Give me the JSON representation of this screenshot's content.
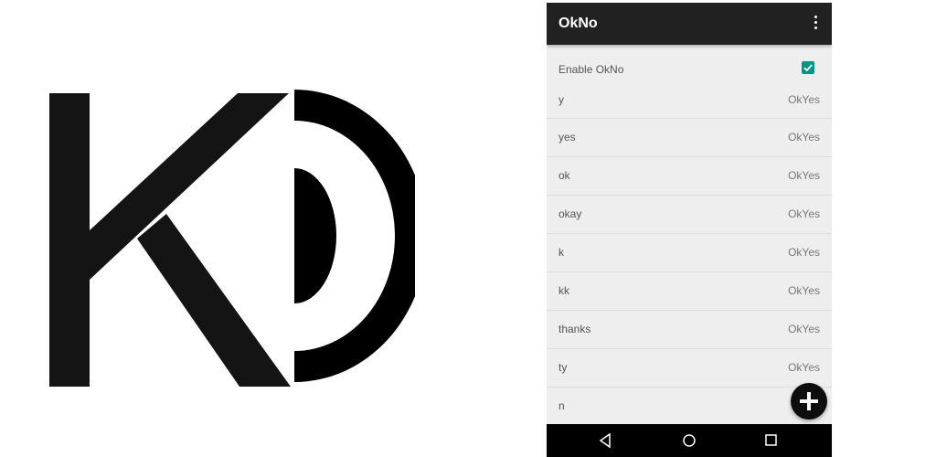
{
  "app": {
    "title": "OkNo"
  },
  "settings": {
    "enable_label": "Enable OkNo",
    "enabled": true
  },
  "replies": [
    {
      "trigger": "y",
      "response": "OkYes"
    },
    {
      "trigger": "yes",
      "response": "OkYes"
    },
    {
      "trigger": "ok",
      "response": "OkYes"
    },
    {
      "trigger": "okay",
      "response": "OkYes"
    },
    {
      "trigger": "k",
      "response": "OkYes"
    },
    {
      "trigger": "kk",
      "response": "OkYes"
    },
    {
      "trigger": "thanks",
      "response": "OkYes"
    },
    {
      "trigger": "ty",
      "response": "OkYes"
    },
    {
      "trigger": "n",
      "response": ""
    }
  ],
  "icons": {
    "menu": "more-vert-icon",
    "check": "checkmark-icon",
    "add": "plus-icon",
    "back": "back-triangle-icon",
    "home": "home-circle-icon",
    "recents": "recents-square-icon"
  },
  "colors": {
    "appbar": "#212121",
    "accent": "#009688",
    "background": "#eeeeee",
    "fab": "#0d0d0d"
  }
}
